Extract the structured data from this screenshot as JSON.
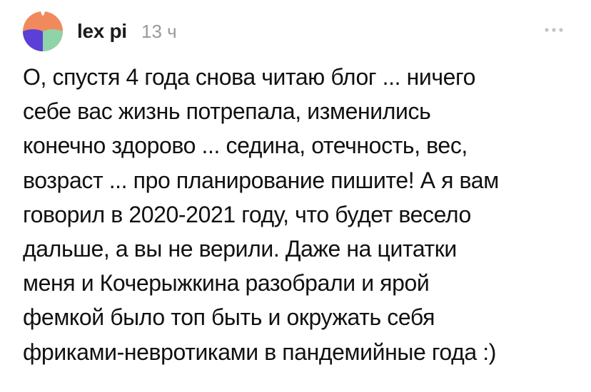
{
  "comment": {
    "author": "lex pi",
    "time": "13 ч",
    "lines": [
      "О, спустя 4 года снова читаю блог ... ничего",
      "себе вас жизнь потрепала, изменились",
      "конечно здорово ... седина, отечность, вес,",
      "возраст ... про планирование пишите! А я вам",
      "говорил в 2020-2021 году, что будет весело",
      "дальше, а вы не верили. Даже на цитатки",
      "меня и Кочерыжкина разобрали и ярой",
      "фемкой было топ быть и окружать себя",
      "фриками-невротиками в пандемийные года :)"
    ],
    "avatar_icon": "avatar-icon",
    "more_icon": "more-options-icon"
  },
  "colors": {
    "avatar_orange": "#f08a5d",
    "avatar_purple": "#5b3fd6",
    "avatar_green": "#8fd3a8",
    "time_gray": "#9a9a9a",
    "more_gray": "#c4c4c4"
  }
}
